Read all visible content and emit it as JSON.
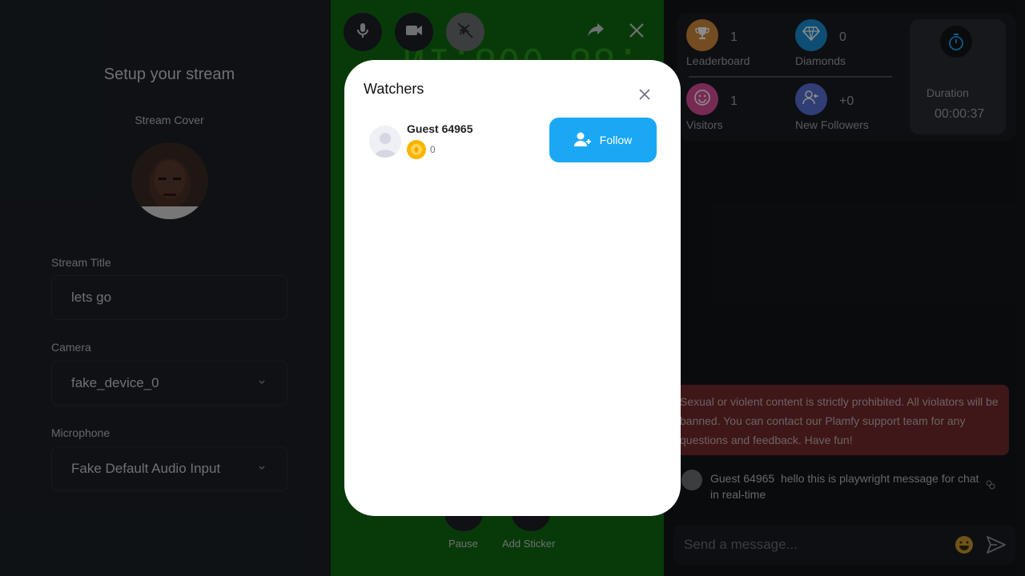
{
  "setup": {
    "title": "Setup your stream",
    "cover_label": "Stream Cover",
    "stream_title_label": "Stream Title",
    "stream_title_value": "lets go",
    "camera_label": "Camera",
    "camera_value": "fake_device_0",
    "microphone_label": "Microphone",
    "microphone_value": "Fake Default Audio Input"
  },
  "video": {
    "mirrored_text": "N1:800 88:"
  },
  "controls": {
    "pause_label": "Pause",
    "sticker_label": "Add Sticker"
  },
  "stats": {
    "leaderboard_value": "1",
    "leaderboard_label": "Leaderboard",
    "diamonds_value": "0",
    "diamonds_label": "Diamonds",
    "visitors_value": "1",
    "visitors_label": "Visitors",
    "new_followers_value": "+0",
    "new_followers_label": "New Followers",
    "duration_label": "Duration",
    "duration_value": "00:00:37"
  },
  "chat": {
    "rules_message": "Sexual or violent content is strictly prohibited. All violators will be banned. You can contact our Plamfy support team for any questions and feedback. Have fun!",
    "messages": [
      {
        "user": "Guest 64965",
        "text": "hello this is playwright message for chat in real-time"
      }
    ],
    "input_placeholder": "Send a message..."
  },
  "modal": {
    "title": "Watchers",
    "watchers": [
      {
        "name": "Guest 64965",
        "coins": "0"
      }
    ],
    "follow_label": "Follow"
  },
  "colors": {
    "follow_button": "#1aa8f5",
    "video_background": "#0f6b12",
    "rules_background": "#732a2d",
    "leaderboard_icon": "#d38a3d",
    "diamonds_icon": "#1a8fd6",
    "visitors_icon": "#d94f9a",
    "new_followers_icon": "#5a6fd6"
  }
}
